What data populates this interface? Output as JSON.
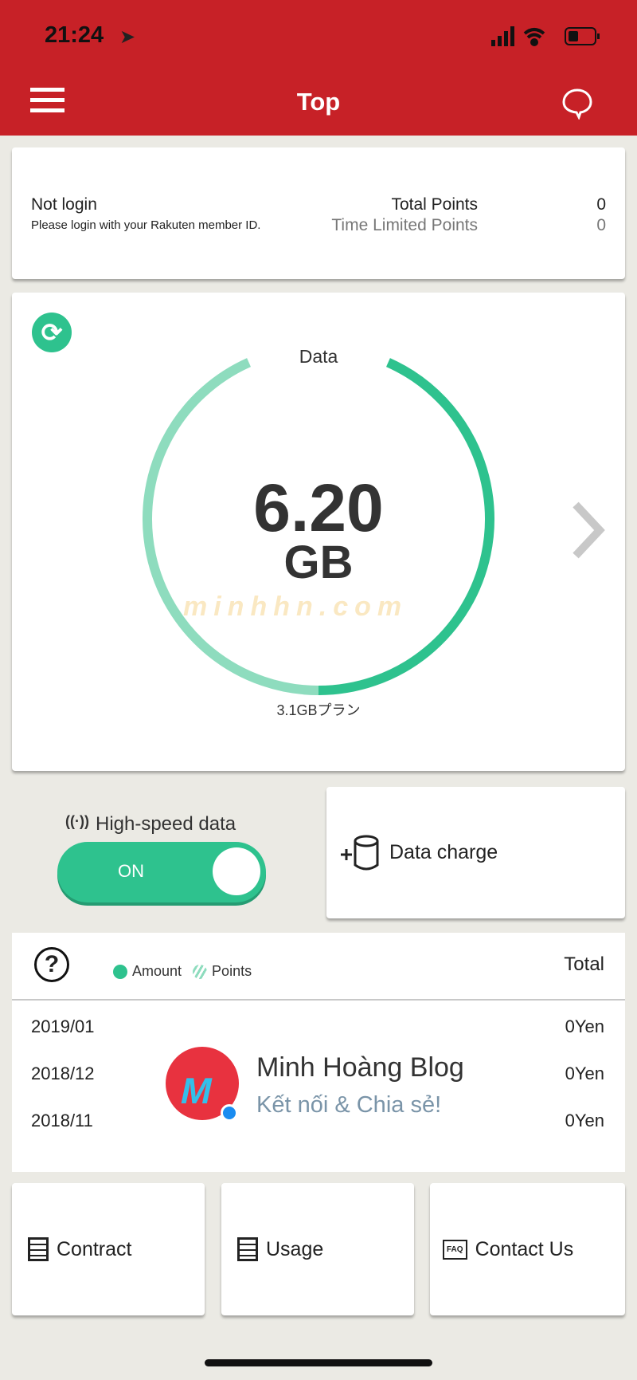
{
  "status": {
    "time": "21:24"
  },
  "header": {
    "title": "Top"
  },
  "account": {
    "status": "Not login",
    "hint": "Please login with your Rakuten member ID.",
    "total_points_label": "Total Points",
    "total_points": "0",
    "limited_points_label": "Time Limited Points",
    "limited_points": "0"
  },
  "data": {
    "label": "Data",
    "value": "6.20",
    "unit": "GB",
    "plan": "3.1GBプラン",
    "remaining_fraction": 0.5,
    "colors": {
      "dark": "#2ec28e",
      "light": "#8edcbe"
    }
  },
  "high_speed": {
    "label": "High-speed data",
    "state": "ON"
  },
  "data_charge": {
    "label": "Data charge"
  },
  "usage": {
    "legend_amount": "Amount",
    "legend_points": "Points",
    "total_label": "Total",
    "rows": [
      {
        "month": "2019/01",
        "value": "0Yen"
      },
      {
        "month": "2018/12",
        "value": "0Yen"
      },
      {
        "month": "2018/11",
        "value": "0Yen"
      }
    ]
  },
  "watermark": {
    "text": "minhhn.com",
    "blog_name": "Minh Hoàng Blog",
    "blog_tagline": "Kết nối & Chia sẻ!"
  },
  "bottom": {
    "contract": "Contract",
    "usage": "Usage",
    "contact": "Contact Us",
    "faq": "FAQ"
  },
  "colors": {
    "brand": "#c72127",
    "accent": "#2ec28e"
  }
}
